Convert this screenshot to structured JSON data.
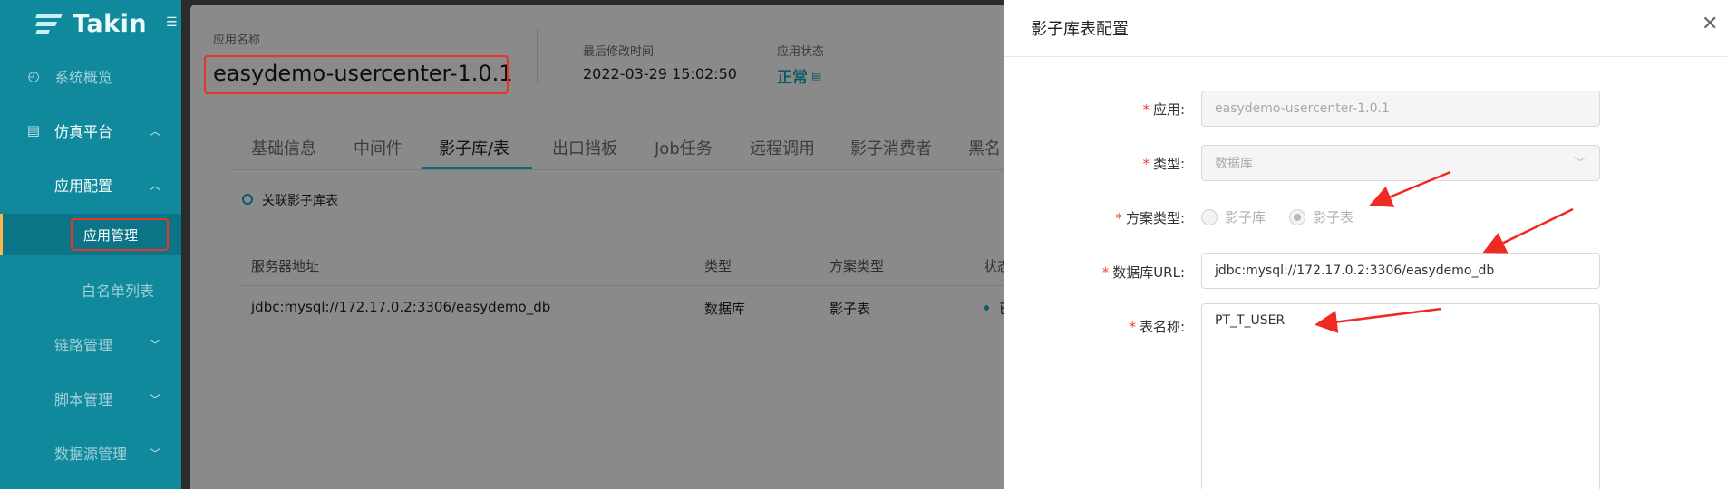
{
  "sidebar": {
    "brand": "Takin",
    "items": [
      {
        "label": "系统概览",
        "icon": "dashboard-icon"
      },
      {
        "label": "仿真平台",
        "icon": "platform-icon",
        "expanded": true
      },
      {
        "label": "应用配置",
        "expanded": true
      },
      {
        "label": "应用管理",
        "active": true
      },
      {
        "label": "白名单列表"
      },
      {
        "label": "链路管理"
      },
      {
        "label": "脚本管理"
      },
      {
        "label": "数据源管理"
      }
    ]
  },
  "header": {
    "app_name_label": "应用名称",
    "app_name": "easydemo-usercenter-1.0.1",
    "modified_label": "最后修改时间",
    "modified_value": "2022-03-29 15:02:50",
    "status_label": "应用状态",
    "status_value": "正常"
  },
  "tabs": [
    "基础信息",
    "中间件",
    "影子库/表",
    "出口挡板",
    "Job任务",
    "远程调用",
    "影子消费者",
    "黑名"
  ],
  "active_tab": "影子库/表",
  "section_title": "关联影子库表",
  "table": {
    "headers": [
      "服务器地址",
      "类型",
      "方案类型",
      "状态"
    ],
    "rows": [
      {
        "server": "jdbc:mysql://172.17.0.2:3306/easydemo_db",
        "type": "数据库",
        "scheme": "影子表",
        "status": "已"
      }
    ]
  },
  "drawer": {
    "title": "影子库表配置",
    "fields": {
      "app_label": "应用:",
      "app_value": "easydemo-usercenter-1.0.1",
      "type_label": "类型:",
      "type_value": "数据库",
      "scheme_label": "方案类型:",
      "scheme_options": [
        "影子库",
        "影子表"
      ],
      "scheme_selected": "影子表",
      "url_label": "数据库URL:",
      "url_value": "jdbc:mysql://172.17.0.2:3306/easydemo_db",
      "table_label": "表名称:",
      "table_value": "PT_T_USER"
    }
  },
  "colors": {
    "sidebar": "#11899d",
    "accent": "#0b6a7a",
    "highlight": "#e8352b",
    "required": "#f0443a"
  }
}
